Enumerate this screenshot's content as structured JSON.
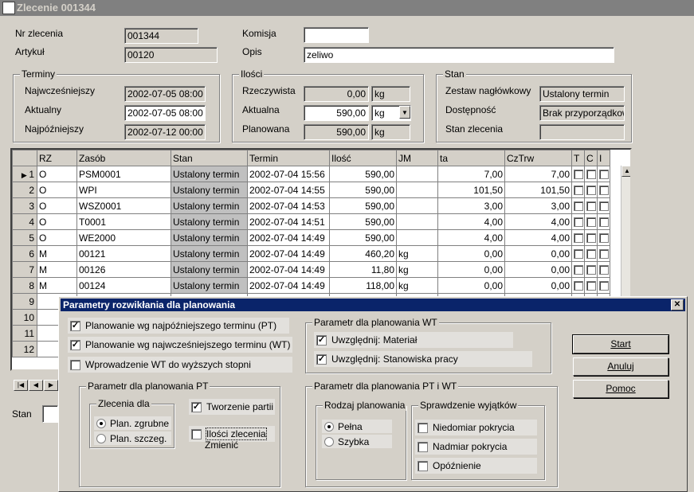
{
  "window": {
    "title": "Zlecenie 001344"
  },
  "header": {
    "nr_label": "Nr zlecenia",
    "nr_value": "001344",
    "artykul_label": "Artykuł",
    "artykul_value": "00120",
    "komisja_label": "Komisja",
    "komisja_value": "",
    "opis_label": "Opis",
    "opis_value": "zeliwo"
  },
  "terminy": {
    "title": "Terminy",
    "najwczesniejszy_label": "Najwcześniejszy",
    "najwczesniejszy_value": "2002-07-05 08:00",
    "aktualny_label": "Aktualny",
    "aktualny_value": "2002-07-05 08:00",
    "najpozniejszy_label": "Najpóźniejszy",
    "najpozniejszy_value": "2002-07-12 00:00"
  },
  "ilosci": {
    "title": "Ilości",
    "rzeczywista_label": "Rzeczywista",
    "rzeczywista_value": "0,00",
    "rzeczywista_unit": "kg",
    "aktualna_label": "Aktualna",
    "aktualna_value": "590,00",
    "aktualna_unit": "kg",
    "planowana_label": "Planowana",
    "planowana_value": "590,00",
    "planowana_unit": "kg"
  },
  "stan": {
    "title": "Stan",
    "zestaw_label": "Zestaw nagłówkowy",
    "zestaw_value": "Ustalony termin",
    "dostepnosc_label": "Dostępność",
    "dostepnosc_value": "Brak przyporządkow",
    "stan_label": "Stan zlecenia",
    "stan_value": ""
  },
  "grid": {
    "columns": [
      "RZ",
      "Zasób",
      "Stan",
      "Termin",
      "Ilość",
      "JM",
      "ta",
      "CzTrw",
      "T",
      "C",
      "I"
    ],
    "rows": [
      {
        "n": "1",
        "rz": "O",
        "zasob": "PSM0001",
        "stan": "Ustalony termin",
        "termin": "2002-07-04 15:56",
        "ilosc": "590,00",
        "jm": "",
        "ta": "7,00",
        "cztrw": "7,00"
      },
      {
        "n": "2",
        "rz": "O",
        "zasob": "WPI",
        "stan": "Ustalony termin",
        "termin": "2002-07-04 14:55",
        "ilosc": "590,00",
        "jm": "",
        "ta": "101,50",
        "cztrw": "101,50"
      },
      {
        "n": "3",
        "rz": "O",
        "zasob": "WSZ0001",
        "stan": "Ustalony termin",
        "termin": "2002-07-04 14:53",
        "ilosc": "590,00",
        "jm": "",
        "ta": "3,00",
        "cztrw": "3,00"
      },
      {
        "n": "4",
        "rz": "O",
        "zasob": "T0001",
        "stan": "Ustalony termin",
        "termin": "2002-07-04 14:51",
        "ilosc": "590,00",
        "jm": "",
        "ta": "4,00",
        "cztrw": "4,00"
      },
      {
        "n": "5",
        "rz": "O",
        "zasob": "WE2000",
        "stan": "Ustalony termin",
        "termin": "2002-07-04 14:49",
        "ilosc": "590,00",
        "jm": "",
        "ta": "4,00",
        "cztrw": "4,00"
      },
      {
        "n": "6",
        "rz": "M",
        "zasob": "00121",
        "stan": "Ustalony termin",
        "termin": "2002-07-04 14:49",
        "ilosc": "460,20",
        "jm": "kg",
        "ta": "0,00",
        "cztrw": "0,00"
      },
      {
        "n": "7",
        "rz": "M",
        "zasob": "00126",
        "stan": "Ustalony termin",
        "termin": "2002-07-04 14:49",
        "ilosc": "11,80",
        "jm": "kg",
        "ta": "0,00",
        "cztrw": "0,00"
      },
      {
        "n": "8",
        "rz": "M",
        "zasob": "00124",
        "stan": "Ustalony termin",
        "termin": "2002-07-04 14:49",
        "ilosc": "118,00",
        "jm": "kg",
        "ta": "0,00",
        "cztrw": "0,00"
      }
    ],
    "empty_rows": [
      "9",
      "10",
      "11",
      "12"
    ]
  },
  "bottom": {
    "stan_label": "Stan"
  },
  "dialog": {
    "title": "Parametry rozwikłania dla planowania",
    "close": "✕",
    "opt_pt": "Planowanie wg najpóźniejszego terminu (PT)",
    "opt_wt": "Planowanie wg najwcześniejszego terminu (WT)",
    "opt_wt_higher": "Wprowadzenie WT do wyższych stopni",
    "wt_group_title": "Parametr dla planowania WT",
    "wt_material": "Uwzględnij: Materiał",
    "wt_stanowiska": "Uwzględnij: Stanowiska pracy",
    "pt_group_title": "Parametr dla planowania PT",
    "zlecenia_title": "Zlecenia dla",
    "plan_zgrubne": "Plan. zgrubne",
    "plan_szczeg": "Plan. szczeg.",
    "tworzenie_partii": "Tworzenie partii",
    "ilosci_zlecenia": "Ilości zlecenia",
    "zmienic": "Zmienić",
    "ptwt_group_title": "Parametr dla planowania PT i WT",
    "rodzaj_title": "Rodzaj planowania",
    "pelna": "Pełna",
    "szybka": "Szybka",
    "wyjatki_title": "Sprawdzenie wyjątków",
    "niedomiar": "Niedomiar pokrycia",
    "nadmiar": "Nadmiar pokrycia",
    "opoznienie": "Opóźnienie",
    "start": "Start",
    "anuluj": "Anuluj",
    "pomoc": "Pomoc"
  }
}
